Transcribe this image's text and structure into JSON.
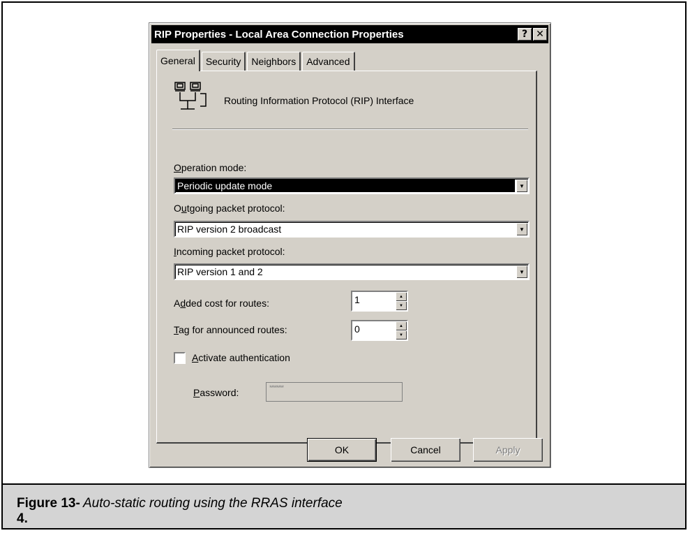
{
  "dialog": {
    "title": "RIP Properties - Local Area Connection Properties",
    "help_glyph": "?",
    "close_glyph": "✕",
    "tabs": [
      {
        "label": "General",
        "active": true
      },
      {
        "label": "Security",
        "active": false
      },
      {
        "label": "Neighbors",
        "active": false
      },
      {
        "label": "Advanced",
        "active": false
      }
    ],
    "header": {
      "icon": "network-connection-icon",
      "text": "Routing Information Protocol (RIP) Interface"
    },
    "operation_mode": {
      "label_key": "O",
      "label_rest": "peration mode:",
      "value": "Periodic update mode"
    },
    "outgoing": {
      "label_pre": "O",
      "label_key": "u",
      "label_rest": "tgoing packet protocol:",
      "value": "RIP version 2 broadcast"
    },
    "incoming": {
      "label_key": "I",
      "label_rest": "ncoming packet protocol:",
      "value": "RIP version 1 and 2"
    },
    "added_cost": {
      "label_pre": "A",
      "label_key": "d",
      "label_rest": "ded cost for routes:",
      "value": "1"
    },
    "tag": {
      "label_key": "T",
      "label_rest": "ag for announced routes:",
      "value": "0"
    },
    "auth": {
      "label_pre": "",
      "label_key": "A",
      "label_rest": "ctivate authentication",
      "checked": false
    },
    "password": {
      "label_key": "P",
      "label_rest": "assword:",
      "value": "********"
    },
    "buttons": {
      "ok": "OK",
      "cancel": "Cancel",
      "apply": "Apply"
    }
  },
  "figure": {
    "label": "Figure 13-4.",
    "caption": "Auto-static routing using the RRAS interface"
  }
}
